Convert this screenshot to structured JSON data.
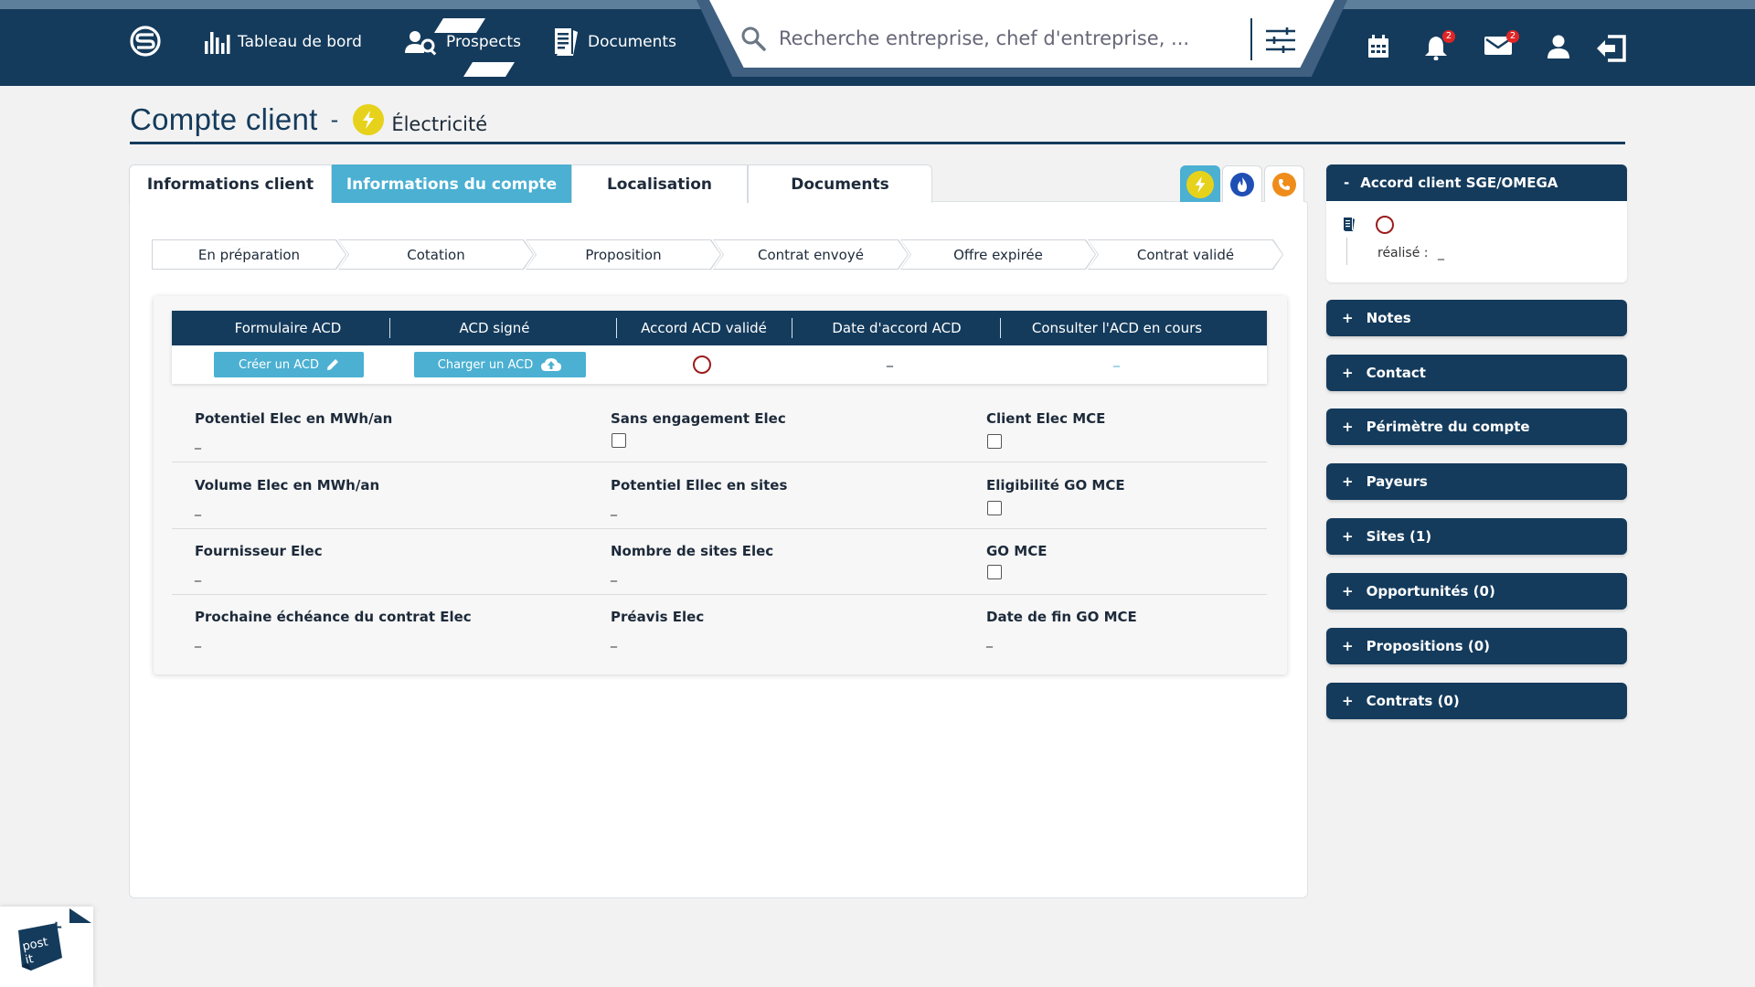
{
  "nav": {
    "dashboard_label": "Tableau de bord",
    "prospects_label": "Prospects",
    "documents_label": "Documents",
    "search_placeholder": "Recherche entreprise, chef d'entreprise, ...",
    "notifications_count": "2",
    "messages_count": "2"
  },
  "page": {
    "title": "Compte client",
    "separator": "-",
    "energy": "Électricité"
  },
  "tabs": [
    {
      "label": "Informations client"
    },
    {
      "label": "Informations du compte",
      "active": true
    },
    {
      "label": "Localisation"
    },
    {
      "label": "Documents"
    }
  ],
  "energy_tabs": [
    {
      "icon": "lightning-icon",
      "color": "#e6d21a",
      "active": true
    },
    {
      "icon": "flame-icon",
      "color": "#1f4fb5"
    },
    {
      "icon": "phone-icon",
      "color": "#ef8c1a"
    }
  ],
  "steps": [
    "En préparation",
    "Cotation",
    "Proposition",
    "Contrat envoyé",
    "Offre expirée",
    "Contrat validé"
  ],
  "acd": {
    "headers": [
      "Formulaire ACD",
      "ACD signé",
      "Accord ACD validé",
      "Date d'accord ACD",
      "Consulter l'ACD en cours"
    ],
    "create_button": "Créer un ACD",
    "upload_button": "Charger un ACD",
    "date_value": "_",
    "consult_value": "_"
  },
  "fields": {
    "potentiel_elec": {
      "label": "Potentiel Elec en MWh/an",
      "value": "_"
    },
    "sans_engagement": {
      "label": "Sans engagement Elec"
    },
    "client_mce": {
      "label": "Client Elec MCE"
    },
    "volume_elec": {
      "label": "Volume Elec en MWh/an",
      "value": "_"
    },
    "potentiel_sites": {
      "label": "Potentiel Ellec en sites",
      "value": "_"
    },
    "eligibilite_go": {
      "label": "Eligibilité GO MCE"
    },
    "fournisseur": {
      "label": "Fournisseur Elec",
      "value": "_"
    },
    "nombre_sites": {
      "label": "Nombre de sites Elec",
      "value": "_"
    },
    "go_mce": {
      "label": "GO MCE"
    },
    "prochaine_echeance": {
      "label": "Prochaine échéance du contrat Elec",
      "value": "_"
    },
    "preavis": {
      "label": "Préavis Elec",
      "value": "_"
    },
    "date_fin_go": {
      "label": "Date de fin GO MCE",
      "value": "_"
    }
  },
  "sidebar": {
    "accord": {
      "toggle": "-",
      "title": "Accord client SGE/OMEGA",
      "realise_label": "réalisé :",
      "realise_value": "_"
    },
    "items": [
      {
        "label": "Notes"
      },
      {
        "label": "Contact"
      },
      {
        "label": "Périmètre du compte"
      },
      {
        "label": "Payeurs"
      },
      {
        "label": "Sites (1)"
      },
      {
        "label": "Opportunités (0)"
      },
      {
        "label": "Propositions (0)"
      },
      {
        "label": "Contrats (0)"
      }
    ],
    "plus_sign": "+"
  },
  "postit": {
    "line1": "post",
    "line2": "it",
    "plus": "+"
  },
  "colors": {
    "navy": "#143b5c",
    "accent": "#4bb0d2",
    "status_red": "#9b1c1c",
    "badge_red": "#e02525"
  }
}
